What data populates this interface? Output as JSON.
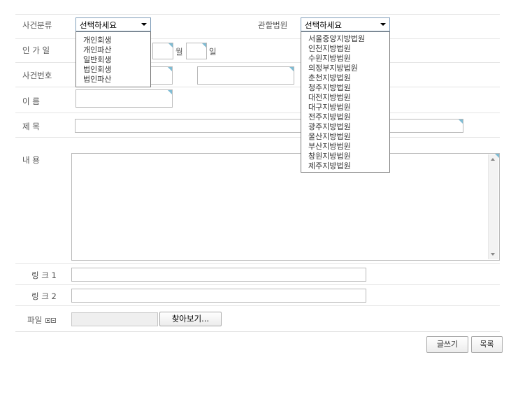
{
  "form": {
    "case_type_label": "사건분류",
    "court_label": "관할법원",
    "authorization_label": "인 가 일",
    "month_label": "월",
    "day_label": "일",
    "case_number_label": "사건번호",
    "name_label": "이    름",
    "title_label": "제    목",
    "content_label": "내    용",
    "link1_label": "링 크 1",
    "link2_label": "링 크 2",
    "file_label": "파일"
  },
  "case_type_select": {
    "selected": "선택하세요",
    "options": [
      "개인회생",
      "개인파산",
      "일반회생",
      "법인회생",
      "법인파산"
    ]
  },
  "court_select": {
    "selected": "선택하세요",
    "options": [
      "서울중앙지방법원",
      "인천지방법원",
      "수원지방법원",
      "의정부지방법원",
      "춘천지방법원",
      "청주지방법원",
      "대전지방법원",
      "대구지방법원",
      "전주지방법원",
      "광주지방법원",
      "울산지방법원",
      "부산지방법원",
      "창원지방법원",
      "제주지방법원"
    ]
  },
  "file_browse_label": "찾아보기...",
  "buttons": {
    "write": "글쓰기",
    "list": "목록"
  },
  "colors": {
    "divider": "#e4e4e4",
    "input_border": "#b9b9b9",
    "corner_accent": "#7fbcd4"
  }
}
